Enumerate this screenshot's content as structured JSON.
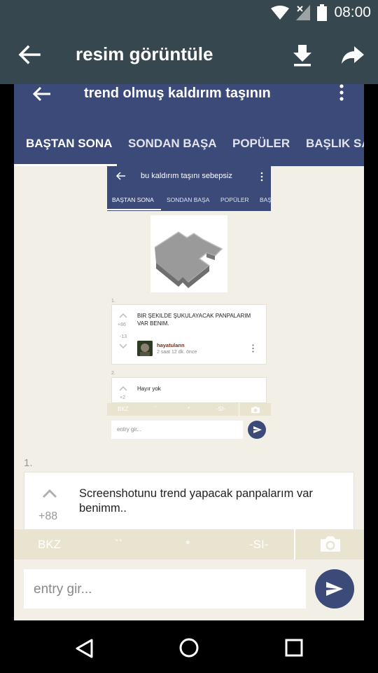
{
  "status_bar": {
    "time": "08:00",
    "icons": [
      "wifi-icon",
      "signal-icon",
      "battery-icon"
    ]
  },
  "viewer": {
    "title": "resim görüntüle",
    "icons": [
      "back-arrow-icon",
      "download-icon",
      "share-icon"
    ]
  },
  "screenshot": {
    "header": {
      "title": "trend olmuş kaldırım taşının"
    },
    "tabs": [
      "BAŞTAN SONA",
      "SONDAN BAŞA",
      "POPÜLER",
      "BAŞLIK SA"
    ],
    "nested": {
      "header": {
        "title": "bu kaldırım taşını sebepsiz"
      },
      "tabs": [
        "BAŞTAN SONA",
        "SONDAN BAŞA",
        "POPÜLER",
        "BAŞ"
      ],
      "entries": [
        {
          "number": "1.",
          "up_score": "+86",
          "down_score": "-13",
          "text": "BIR ŞEKILDE ŞUKULAYACAK PANPALARIM VAR BENIM.",
          "author": "hayatulann",
          "time": "2 saat 12 dk. önce"
        },
        {
          "number": "2.",
          "up_score": "+2",
          "text": "Hayır yok"
        }
      ],
      "keys": [
        "BKZ",
        "``",
        "*",
        "-SI-"
      ],
      "input_placeholder": "entry gir..."
    },
    "entry": {
      "number": "1.",
      "score": "+88",
      "text": "Screenshotunu trend yapacak panpalarım var benimm.."
    },
    "keys": [
      "BKZ",
      "``",
      "*",
      "-SI-"
    ],
    "input_placeholder": "entry gir..."
  },
  "colors": {
    "header": "#3c4a7a",
    "viewer_bar": "#37474f",
    "background": "#f2efe6",
    "key_bar": "#e8e4cf"
  }
}
